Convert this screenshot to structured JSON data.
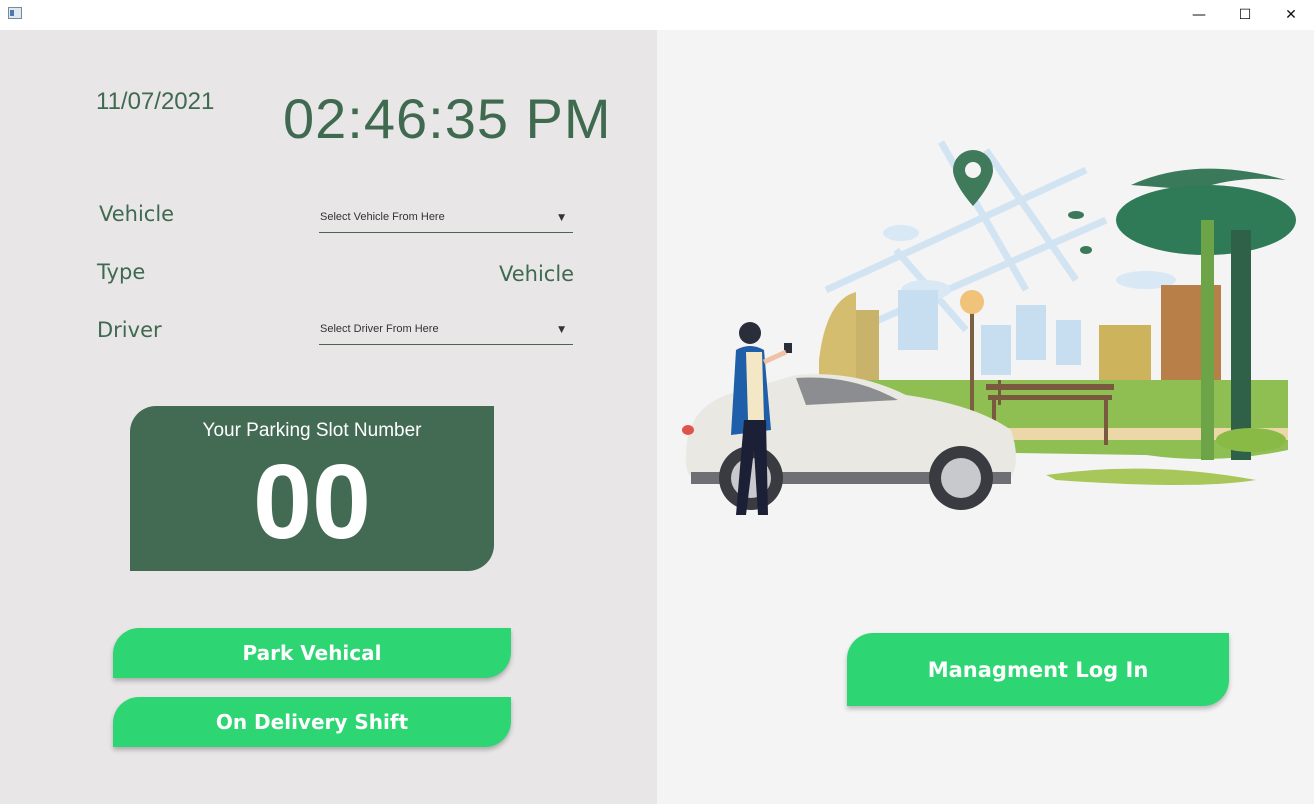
{
  "window": {
    "minimize_glyph": "—",
    "maximize_glyph": "☐",
    "close_glyph": "✕"
  },
  "header": {
    "date": "11/07/2021",
    "time": "02:46:35 PM"
  },
  "form": {
    "vehicle_label": "Vehicle",
    "vehicle_select": "Select Vehicle From Here",
    "type_label": "Type",
    "type_value": "Vehicle",
    "driver_label": "Driver",
    "driver_select": "Select Driver From Here"
  },
  "slot": {
    "title": "Your Parking Slot Number",
    "number": "00"
  },
  "buttons": {
    "park": "Park Vehical",
    "delivery": "On Delivery Shift",
    "management": "Managment Log In"
  },
  "colors": {
    "accent": "#2ed573",
    "primary": "#436b53",
    "left_bg": "#e8e6e7",
    "right_bg": "#f4f4f5"
  }
}
